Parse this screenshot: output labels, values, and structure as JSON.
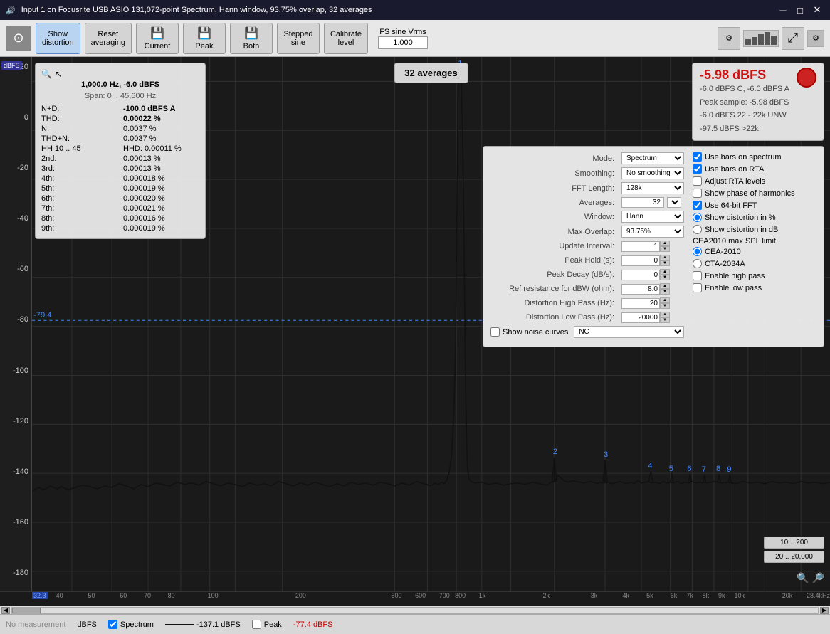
{
  "window": {
    "title": "Input 1 on Focusrite USB ASIO 131,072-point Spectrum, Hann window, 93.75% overlap, 32 averages"
  },
  "toolbar": {
    "show_distortion_label": "Show\ndistortion",
    "reset_averaging_label": "Reset\naveraging",
    "current_label": "Current",
    "peak_label": "Peak",
    "both_label": "Both",
    "stepped_sine_label": "Stepped\nsine",
    "calibrate_level_label": "Calibrate\nlevel",
    "fs_sine_vrms_label": "FS sine Vrms",
    "vrms_value": "1.000"
  },
  "chart": {
    "y_axis": [
      "20",
      "0",
      "-20",
      "-40",
      "-60",
      "-80",
      "-100",
      "-120",
      "-140",
      "-160",
      "-180"
    ],
    "y_unit": "dBFS",
    "averages_badge": "32 averages",
    "x_labels": [
      "32.3",
      "40",
      "50",
      "60",
      "70",
      "80",
      "100",
      "200",
      "500",
      "600",
      "700",
      "800",
      "1k",
      "2k",
      "3k",
      "4k",
      "5k",
      "6k",
      "7k",
      "8k",
      "9k",
      "10k",
      "20k",
      "28.4kHz"
    ],
    "horizontal_line_val": "-79.4",
    "info_panel": {
      "title": "1,000.0 Hz, -6.0 dBFS",
      "span": "Span: 0 .. 45,600 Hz",
      "nd_label": "N+D:",
      "nd_val": "-100.0 dBFS A",
      "thd_label": "THD:",
      "thd_val": "0.00022 %",
      "n_label": "N:",
      "n_val": "0.0037 %",
      "thd_n_label": "THD+N:",
      "thd_n_val": "0.0037 %",
      "hh_label": "HH 10 .. 45",
      "hhd_label": "HHD:",
      "hhd_val": "0.00011 %",
      "h2_label": "2nd:",
      "h2_val": "0.00013 %",
      "h3_label": "3rd:",
      "h3_val": "0.00013 %",
      "h4_label": "4th:",
      "h4_val": "0.000018 %",
      "h5_label": "5th:",
      "h5_val": "0.000019 %",
      "h6_label": "6th:",
      "h6_val": "0.000020 %",
      "h7_label": "7th:",
      "h7_val": "0.000021 %",
      "h8_label": "8th:",
      "h8_val": "0.000016 %",
      "h9_label": "9th:",
      "h9_val": "0.000019 %"
    },
    "level_panel": {
      "level": "-5.98 dBFS",
      "detail1": "-6.0 dBFS C, -6.0 dBFS A",
      "detail2": "Peak sample: -5.98 dBFS",
      "detail3": "-6.0 dBFS 22 - 22k UNW",
      "detail4": "-97.5 dBFS >22k"
    }
  },
  "settings": {
    "mode_label": "Mode:",
    "mode_val": "Spectrum",
    "smoothing_label": "Smoothing:",
    "smoothing_val": "No  smoothing",
    "fft_length_label": "FFT Length:",
    "fft_length_val": "128k",
    "averages_label": "Averages:",
    "averages_val": "32",
    "window_label": "Window:",
    "window_val": "Hann",
    "max_overlap_label": "Max Overlap:",
    "max_overlap_val": "93.75%",
    "update_interval_label": "Update Interval:",
    "update_interval_val": "1",
    "peak_hold_label": "Peak Hold (s):",
    "peak_hold_val": "0",
    "peak_decay_label": "Peak Decay (dB/s):",
    "peak_decay_val": "0",
    "ref_resistance_label": "Ref resistance for dBW (ohm):",
    "ref_resistance_val": "8.0",
    "dist_high_pass_label": "Distortion High Pass (Hz):",
    "dist_high_pass_val": "20",
    "dist_low_pass_label": "Distortion Low Pass (Hz):",
    "dist_low_pass_val": "20000",
    "show_noise_label": "Show noise curves",
    "noise_val": "NC",
    "checks": {
      "use_bars_spectrum": "Use bars on spectrum",
      "use_bars_rta": "Use bars on RTA",
      "adjust_rta": "Adjust RTA levels",
      "show_phase": "Show phase of harmonics",
      "use_64bit": "Use 64-bit FFT",
      "show_dist_pct": "Show distortion in %",
      "show_dist_db": "Show distortion in dB",
      "cea2010_label": "CEA2010 max SPL limit:",
      "cea2010_opt": "CEA-2010",
      "cta2034_opt": "CTA-2034A",
      "enable_high_pass": "Enable high pass",
      "enable_low_pass": "Enable low pass"
    }
  },
  "range_buttons": {
    "r1": "10 .. 200",
    "r2": "20 .. 20,000"
  },
  "status_bar": {
    "no_measurement": "No measurement",
    "dbfs": "dBFS",
    "spectrum_checked": true,
    "spectrum_label": "Spectrum",
    "spectrum_level": "-137.1 dBFS",
    "peak_label": "Peak",
    "peak_level": "-77.4 dBFS"
  }
}
